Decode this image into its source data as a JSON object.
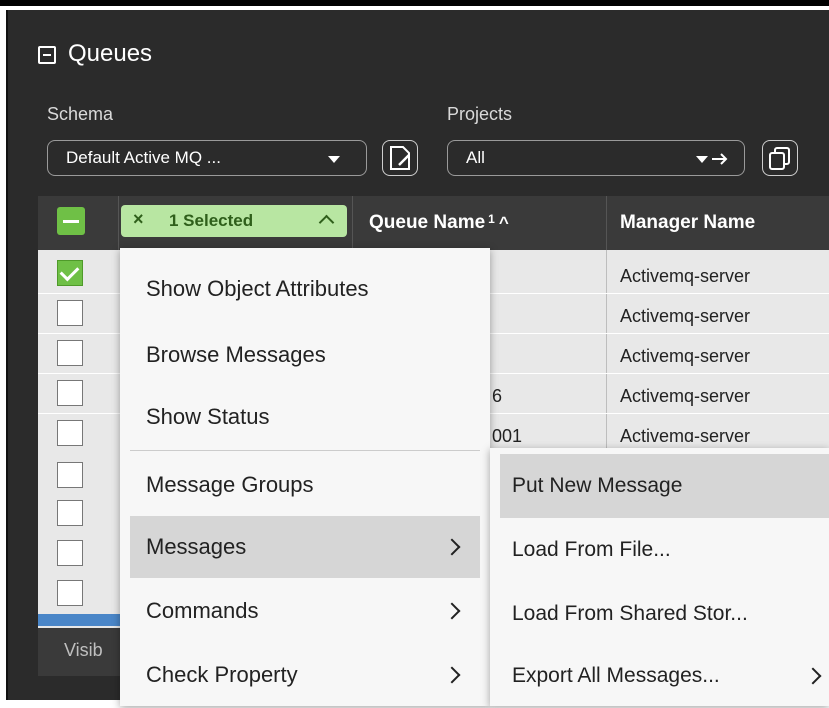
{
  "panel": {
    "title": "Queues",
    "schema_label": "Schema",
    "schema_value": "Default Active MQ ...",
    "projects_label": "Projects",
    "projects_value": "All"
  },
  "table": {
    "selected_badge": "1 Selected",
    "columns": [
      "Queue Name",
      "Manager Name"
    ],
    "sort_index": "1",
    "sort_arrow": "^",
    "rows": [
      {
        "checked": true,
        "queue_name": "",
        "manager_name": "Activemq-server"
      },
      {
        "checked": false,
        "queue_name": "",
        "manager_name": "Activemq-server"
      },
      {
        "checked": false,
        "queue_name": "",
        "manager_name": "Activemq-server"
      },
      {
        "checked": false,
        "queue_name": "6",
        "manager_name": "Activemq-server"
      },
      {
        "checked": false,
        "queue_name": "001",
        "manager_name": "Activemq-server"
      },
      {
        "checked": false,
        "queue_name": "",
        "manager_name": ""
      },
      {
        "checked": false,
        "queue_name": "",
        "manager_name": ""
      },
      {
        "checked": false,
        "queue_name": "",
        "manager_name": ""
      },
      {
        "checked": false,
        "queue_name": "",
        "manager_name": ""
      }
    ],
    "footer_text": "Visib"
  },
  "context_menu": {
    "items": [
      {
        "label": "Show Object Attributes",
        "submenu": false
      },
      {
        "label": "Browse Messages",
        "submenu": false
      },
      {
        "label": "Show Status",
        "submenu": false
      },
      {
        "label": "Message Groups",
        "submenu": false
      },
      {
        "label": "Messages",
        "submenu": true,
        "active": true
      },
      {
        "label": "Commands",
        "submenu": true
      },
      {
        "label": "Check Property",
        "submenu": true
      }
    ]
  },
  "submenu": {
    "items": [
      {
        "label": "Put New Message",
        "active": true
      },
      {
        "label": "Load From File..."
      },
      {
        "label": "Load From Shared Stor..."
      },
      {
        "label": "Export All Messages...",
        "submenu": true
      }
    ]
  },
  "colors": {
    "panel_bg": "#2b2b2b",
    "accent_green": "#6fc046",
    "badge_bg": "#b8e6a2",
    "menu_bg": "#f7f7f7",
    "menu_active": "#d6d6d6"
  }
}
